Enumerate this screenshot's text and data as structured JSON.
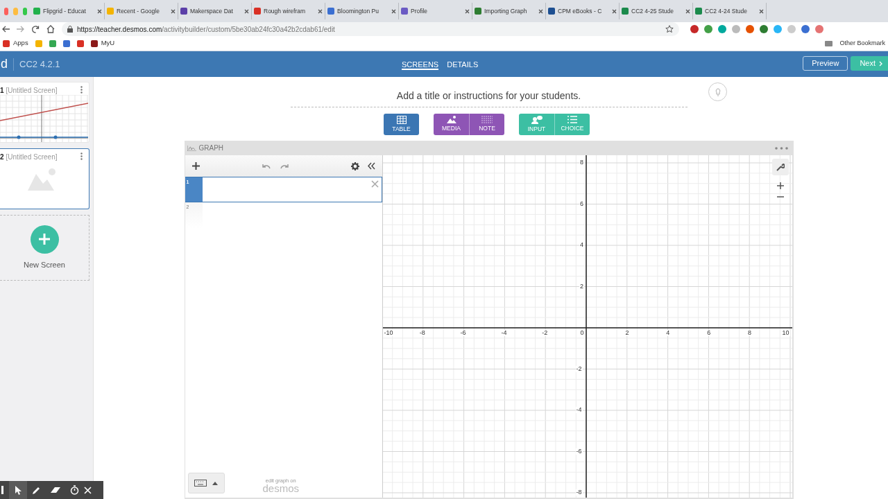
{
  "browser": {
    "tabs": [
      {
        "label": "Flipgrid - Educat",
        "color": "#22b14c"
      },
      {
        "label": "Recent - Google",
        "color": "#f4b400"
      },
      {
        "label": "Makerspace Dat",
        "color": "#5b3fa8"
      },
      {
        "label": "Rough wirefram",
        "color": "#d93025"
      },
      {
        "label": "Bloomington Pu",
        "color": "#3b6fd1"
      },
      {
        "label": "Profile",
        "color": "#6b5bc4"
      },
      {
        "label": "Importing Graph",
        "color": "#2e7d32"
      },
      {
        "label": "CPM eBooks - C",
        "color": "#1d4f91"
      },
      {
        "label": "CC2 4-25 Stude",
        "color": "#1b8a4c"
      },
      {
        "label": "CC2 4-24 Stude",
        "color": "#1b8a4c"
      }
    ],
    "url_host": "https://teacher.desmos.com",
    "url_path": "/activitybuilder/custom/5be30ab24fc30a42b2cdab61/edit",
    "bookmarks": [
      {
        "label": "Apps",
        "color": "#d93025"
      },
      {
        "color": "#f4b400"
      },
      {
        "color": "#34a853"
      },
      {
        "color": "#3b6fd1"
      },
      {
        "color": "#d93025"
      },
      {
        "label": "MyU",
        "color": "#8b1a1a"
      }
    ],
    "other_bookmarks": "Other Bookmark"
  },
  "header": {
    "logo": "d",
    "activity": "CC2 4.2.1",
    "nav": [
      {
        "label": "SCREENS",
        "selected": true
      },
      {
        "label": "DETAILS",
        "selected": false
      }
    ],
    "preview": "Preview",
    "next": "Next"
  },
  "screens": [
    {
      "number": "1",
      "title": "[Untitled Screen]",
      "selected": false,
      "kind": "graph"
    },
    {
      "number": "2",
      "title": "[Untitled Screen]",
      "selected": true,
      "kind": "media"
    }
  ],
  "new_screen": "New Screen",
  "title_placeholder": "Add a title or instructions for your students.",
  "component_groups": [
    {
      "color": "#3b76b3",
      "items": [
        {
          "label": "TABLE",
          "kind": "table"
        }
      ]
    },
    {
      "color": "#8e55b5",
      "items": [
        {
          "label": "MEDIA",
          "kind": "media"
        },
        {
          "label": "NOTE",
          "kind": "note"
        }
      ]
    },
    {
      "color": "#3cbfa3",
      "items": [
        {
          "label": "INPUT",
          "kind": "input"
        },
        {
          "label": "CHOICE",
          "kind": "choice"
        }
      ]
    }
  ],
  "graph": {
    "title": "GRAPH",
    "expressions": [
      {
        "number": "1",
        "selected": true
      },
      {
        "number": "2",
        "selected": false
      }
    ],
    "edit_on": "edit graph on",
    "brand": "desmos",
    "x_labels": [
      "-10",
      "-8",
      "-6",
      "-4",
      "-2",
      "0",
      "2",
      "4",
      "6",
      "8",
      "10"
    ],
    "y_labels": [
      "8",
      "6",
      "4",
      "2",
      "-2",
      "-4",
      "-6",
      "-8"
    ]
  }
}
